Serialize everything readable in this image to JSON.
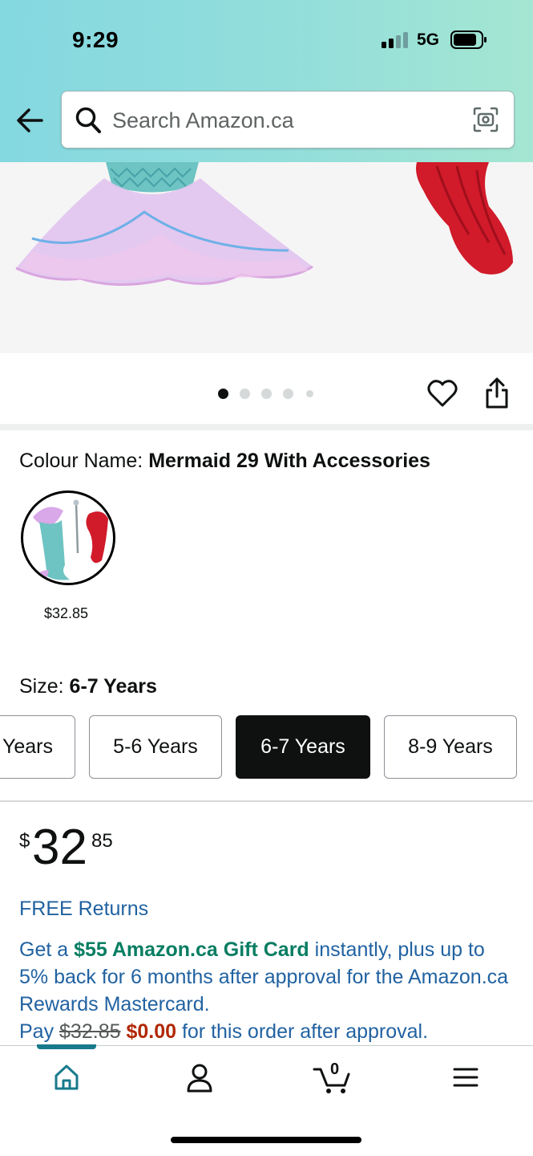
{
  "status_bar": {
    "time": "9:29",
    "network": "5G"
  },
  "search": {
    "placeholder": "Search Amazon.ca"
  },
  "product": {
    "colour_label": "Colour Name:",
    "colour_value": "Mermaid 29 With Accessories",
    "swatch_price": "$32.85",
    "size_label": "Size:",
    "size_value": "6-7 Years",
    "sizes": [
      "Years",
      "5-6 Years",
      "6-7 Years",
      "8-9 Years"
    ],
    "selected_size": "6-7 Years",
    "price": {
      "symbol": "$",
      "whole": "32",
      "fraction": "85"
    },
    "free_returns": "FREE Returns",
    "promo": {
      "part1": "Get a ",
      "gift_card": "$55 Amazon.ca Gift Card",
      "part2": " instantly, plus up to 5% back for 6 months after approval for the Amazon.ca Rewards Mastercard.",
      "pay": "Pay ",
      "old_price": "$32.85",
      "new_price": "$0.00",
      "part3": " for this order after approval."
    }
  },
  "carousel": {
    "dot_count": 5,
    "active_index": 0
  },
  "bottom_nav": {
    "cart_count": "0"
  },
  "colors": {
    "accent": "#187a8c",
    "link": "#2162a1",
    "deal_green": "#067d62",
    "price_red": "#b12704"
  }
}
